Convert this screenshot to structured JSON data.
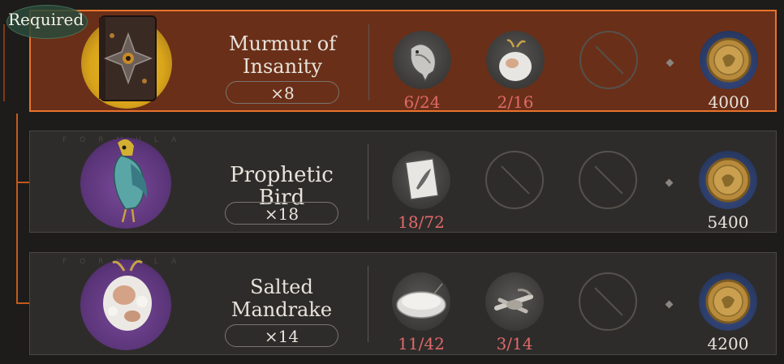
{
  "badge": {
    "label": "Required"
  },
  "recipes": [
    {
      "name": "Murmur of Insanity",
      "quantity": "×8",
      "selected": true,
      "item_icon": "dark-grimoire-book-icon",
      "ingredients": [
        {
          "icon": "raven-figurine-icon",
          "count": "6/24"
        },
        {
          "icon": "salted-mandrake-icon",
          "count": "2/16"
        }
      ],
      "empty_slots": 1,
      "cost": {
        "icon": "gold-coin-icon",
        "amount": "4000"
      }
    },
    {
      "name": "Prophetic Bird",
      "quantity": "×18",
      "selected": false,
      "watermark": "FORMULA",
      "item_icon": "prophetic-bird-icon",
      "ingredients": [
        {
          "icon": "feather-card-icon",
          "count": "18/72"
        }
      ],
      "empty_slots": 2,
      "cost": {
        "icon": "gold-coin-icon",
        "amount": "5400"
      }
    },
    {
      "name": "Salted Mandrake",
      "quantity": "×14",
      "selected": false,
      "watermark": "FORMULA",
      "item_icon": "salted-mandrake-icon",
      "ingredients": [
        {
          "icon": "salt-bowl-icon",
          "count": "11/42"
        },
        {
          "icon": "mandrake-root-icon",
          "count": "3/14"
        }
      ],
      "empty_slots": 1,
      "cost": {
        "icon": "gold-coin-icon",
        "amount": "4200"
      }
    }
  ],
  "colors": {
    "selected_border": "#e8732b",
    "insufficient_count": "#e0696a",
    "row_bg": "#2e2c2a",
    "selected_row_bg": "#6a2f18"
  }
}
